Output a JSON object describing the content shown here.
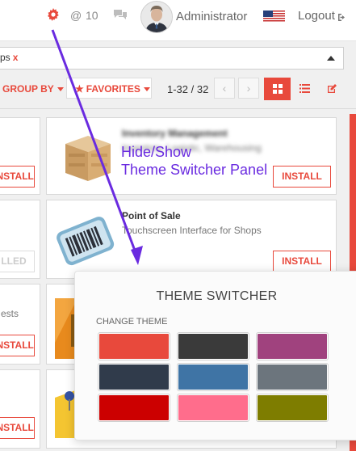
{
  "topbar": {
    "notifications_count": "10",
    "username": "Administrator",
    "logout_label": "Logout",
    "icons": [
      "gear-icon",
      "at-icon",
      "chat-icon",
      "avatar",
      "us-flag-icon",
      "logout-icon"
    ]
  },
  "search": {
    "facet_label": "ps",
    "facet_remove": "x"
  },
  "toolbar": {
    "group_by": "GROUP BY",
    "favorites": "FAVORITES",
    "pager": "1-32 / 32"
  },
  "cards": {
    "install_label": "INSTALL",
    "installed_label": "LLED",
    "partial_text": "ests",
    "inventory_title": "Inventory Management",
    "inventory_sub": "Inventory, Logistic, Warehousing",
    "pos_title": "Point of Sale",
    "pos_sub": "Touchscreen Interface for Shops"
  },
  "theme_switcher": {
    "title": "THEME SWITCHER",
    "change_label": "CHANGE THEME",
    "swatches": [
      "#e8493c",
      "#3a3a3a",
      "#a0427e",
      "#303b4b",
      "#3f74a5",
      "#6c757d",
      "#cc0000",
      "#ff6d8c",
      "#7e7d00"
    ]
  },
  "annotation": {
    "line1": "Hide/Show",
    "line2": "Theme Switcher Panel"
  },
  "colors": {
    "accent": "#e8493c",
    "annotation": "#6a2be0"
  }
}
